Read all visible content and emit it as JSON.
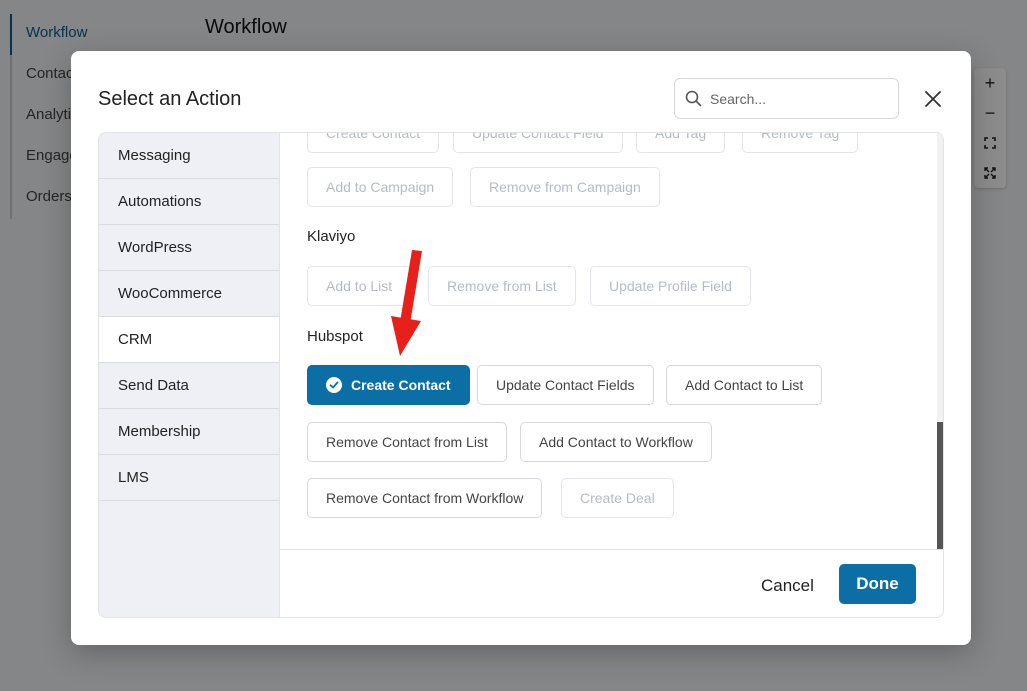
{
  "background": {
    "nav": [
      "Workflow",
      "Contacts",
      "Analytics",
      "Engagement",
      "Orders"
    ],
    "title": "Workflow",
    "zoom": [
      "+",
      "−"
    ]
  },
  "modal": {
    "title": "Select an Action",
    "search_placeholder": "Search...",
    "sidebar": [
      "Messaging",
      "Automations",
      "WordPress",
      "WooCommerce",
      "CRM",
      "Send Data",
      "Membership",
      "LMS"
    ],
    "active_sidebar": "CRM",
    "top_partial_buttons": [
      "Create Contact",
      "Update Contact Field",
      "Add Tag",
      "Remove Tag"
    ],
    "top_buttons": [
      "Add to Campaign",
      "Remove from Campaign"
    ],
    "klaviyo": {
      "label": "Klaviyo",
      "buttons": [
        "Add to List",
        "Remove from List",
        "Update Profile Field"
      ]
    },
    "hubspot": {
      "label": "Hubspot",
      "buttons": [
        "Create Contact",
        "Update Contact Fields",
        "Add Contact to List",
        "Remove Contact from List",
        "Add Contact to Workflow",
        "Remove Contact from Workflow",
        "Create Deal"
      ],
      "selected": "Create Contact"
    },
    "footer": {
      "cancel": "Cancel",
      "done": "Done"
    }
  },
  "colors": {
    "accent": "#0b6fa6",
    "arrow": "#e8201a"
  }
}
